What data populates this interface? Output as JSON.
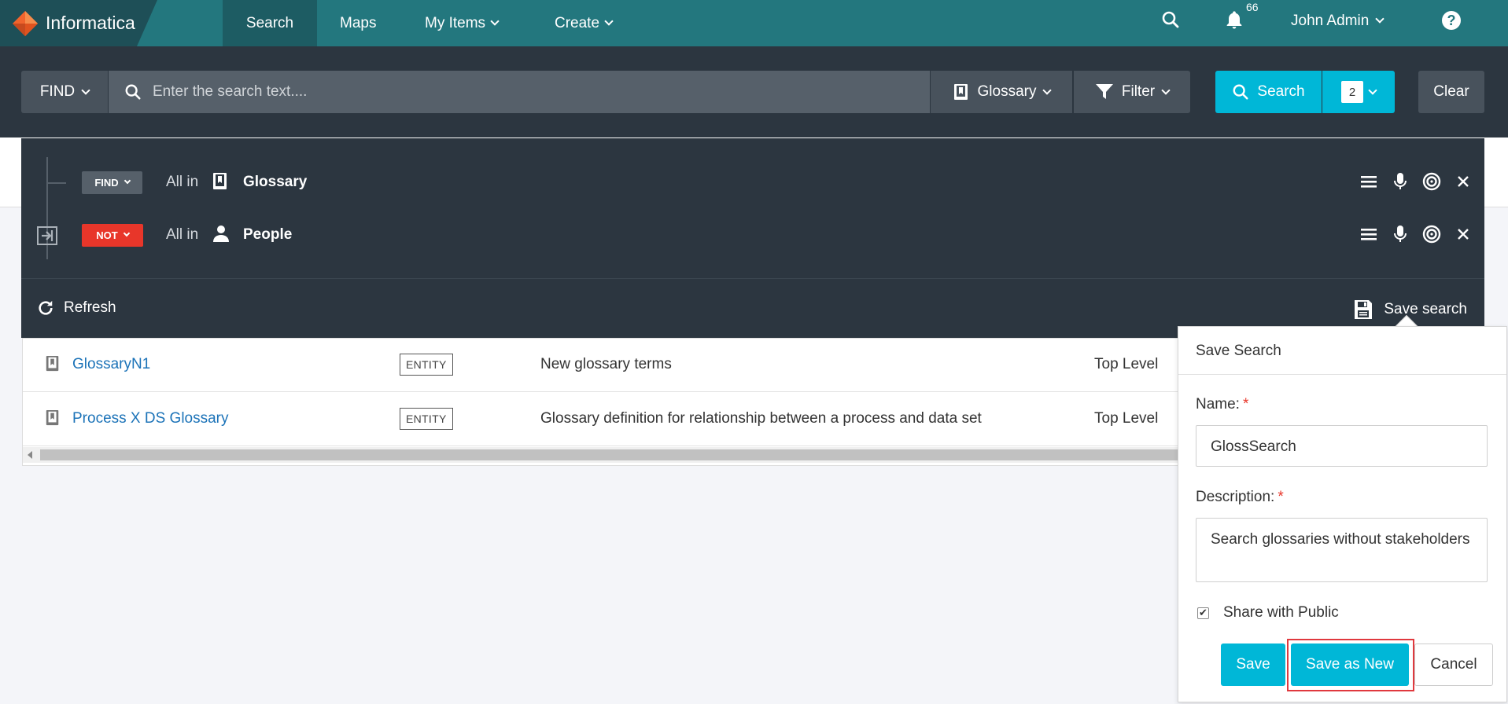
{
  "app": {
    "logo_text": "Informatica"
  },
  "nav": {
    "items": [
      {
        "label": "Search"
      },
      {
        "label": "Maps"
      },
      {
        "label": "My Items"
      },
      {
        "label": "Create"
      }
    ],
    "notification_count": "66",
    "user_name": "John Admin",
    "help": "?"
  },
  "searchbar": {
    "find_label": "FIND",
    "placeholder": "Enter the search text....",
    "scope_label": "Glossary",
    "filter_label": "Filter",
    "search_label": "Search",
    "count": "2",
    "clear_label": "Clear"
  },
  "query": {
    "rows": [
      {
        "operator": "FIND",
        "prefix": "All in",
        "scope": "Glossary",
        "scope_icon": "book-icon"
      },
      {
        "operator": "NOT",
        "prefix": "All in",
        "scope": "People",
        "scope_icon": "person-icon"
      }
    ],
    "refresh_label": "Refresh",
    "save_search_label": "Save search"
  },
  "results": [
    {
      "name": "GlossaryN1",
      "type": "ENTITY",
      "description": "New glossary terms",
      "level": "Top Level"
    },
    {
      "name": "Process X DS Glossary",
      "type": "ENTITY",
      "description": "Glossary definition for relationship between a process and data set",
      "level": "Top Level"
    }
  ],
  "save_dialog": {
    "title": "Save Search",
    "name_label": "Name:",
    "name_value": "GlossSearch",
    "description_label": "Description:",
    "description_value": "Search glossaries without stakeholders",
    "required_mark": "*",
    "share_label": "Share with Public",
    "share_checked": true,
    "save_label": "Save",
    "save_as_new_label": "Save as New",
    "cancel_label": "Cancel"
  },
  "colors": {
    "nav_bg": "#23777e",
    "panel_bg": "#2c3640",
    "accent": "#00b7d7",
    "not_red": "#e8362a",
    "link": "#1c73b8"
  }
}
